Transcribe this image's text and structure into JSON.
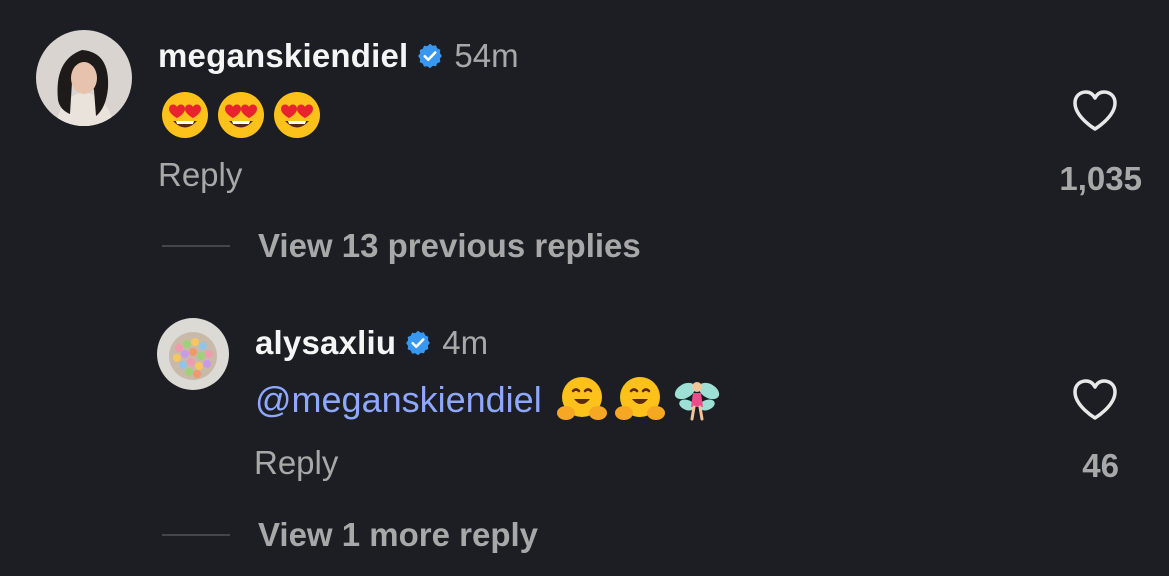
{
  "comments": [
    {
      "username": "meganskiendiel",
      "time": "54m",
      "emojis": [
        "heart-eyes-emoji",
        "heart-eyes-emoji",
        "heart-eyes-emoji"
      ],
      "reply_label": "Reply",
      "like_count": "1,035"
    },
    {
      "username": "alysaxliu",
      "time": "4m",
      "mention": "@meganskiendiel",
      "emojis": [
        "hugging-face-emoji",
        "hugging-face-emoji",
        "fairy-emoji"
      ],
      "reply_label": "Reply",
      "like_count": "46"
    }
  ],
  "view_previous_replies": "View 13 previous replies",
  "view_more_reply": "View 1 more reply",
  "colors": {
    "background": "#1c1e23",
    "primary_text": "#f5f5f5",
    "secondary_text": "#a8a8a8",
    "mention": "#8ea7ff",
    "verified_badge": "#3897f0"
  }
}
